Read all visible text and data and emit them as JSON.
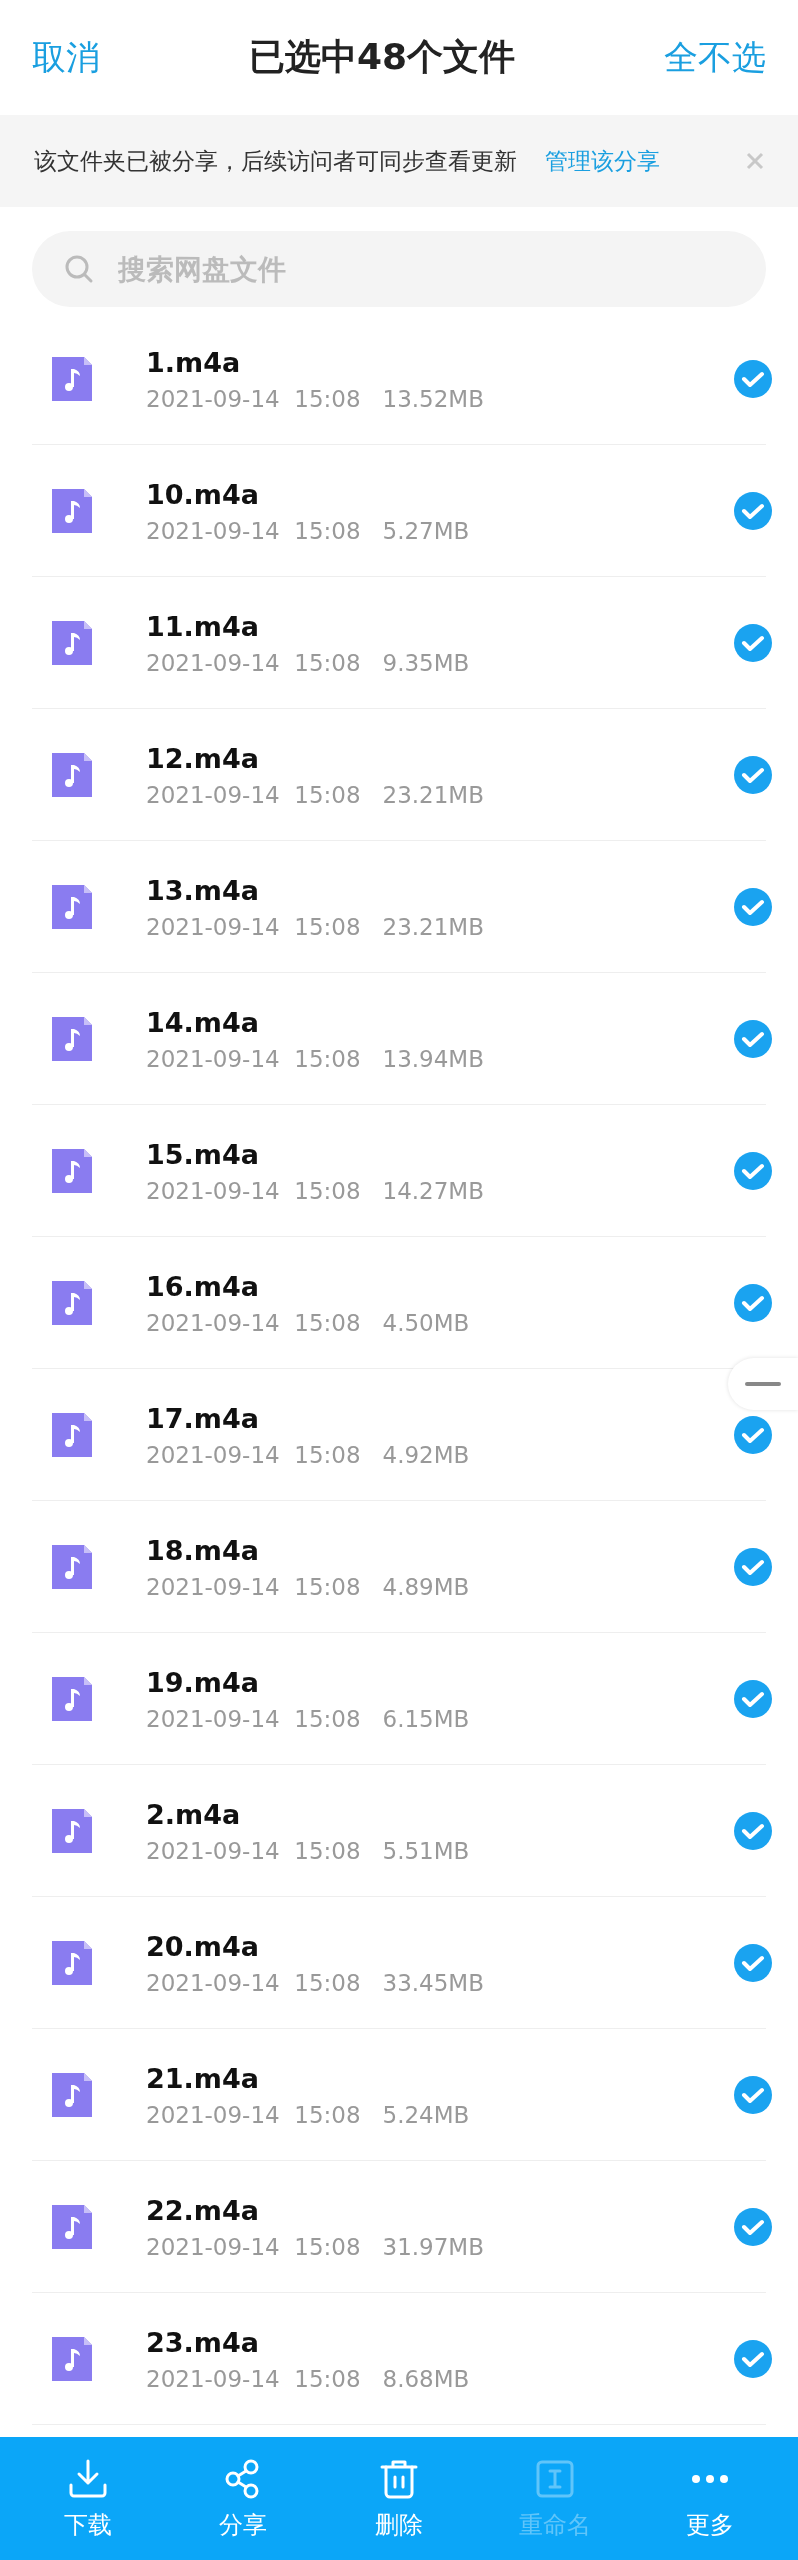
{
  "header": {
    "cancel": "取消",
    "title": "已选中48个文件",
    "deselect_all": "全不选"
  },
  "banner": {
    "message": "该文件夹已被分享，后续访问者可同步查看更新",
    "link": "管理该分享"
  },
  "search": {
    "placeholder": "搜索网盘文件"
  },
  "files": [
    {
      "name": "1.m4a",
      "date": "2021-09-14",
      "time": "15:08",
      "size": "13.52MB",
      "selected": true
    },
    {
      "name": "10.m4a",
      "date": "2021-09-14",
      "time": "15:08",
      "size": "5.27MB",
      "selected": true
    },
    {
      "name": "11.m4a",
      "date": "2021-09-14",
      "time": "15:08",
      "size": "9.35MB",
      "selected": true
    },
    {
      "name": "12.m4a",
      "date": "2021-09-14",
      "time": "15:08",
      "size": "23.21MB",
      "selected": true
    },
    {
      "name": "13.m4a",
      "date": "2021-09-14",
      "time": "15:08",
      "size": "23.21MB",
      "selected": true
    },
    {
      "name": "14.m4a",
      "date": "2021-09-14",
      "time": "15:08",
      "size": "13.94MB",
      "selected": true
    },
    {
      "name": "15.m4a",
      "date": "2021-09-14",
      "time": "15:08",
      "size": "14.27MB",
      "selected": true
    },
    {
      "name": "16.m4a",
      "date": "2021-09-14",
      "time": "15:08",
      "size": "4.50MB",
      "selected": true
    },
    {
      "name": "17.m4a",
      "date": "2021-09-14",
      "time": "15:08",
      "size": "4.92MB",
      "selected": true
    },
    {
      "name": "18.m4a",
      "date": "2021-09-14",
      "time": "15:08",
      "size": "4.89MB",
      "selected": true
    },
    {
      "name": "19.m4a",
      "date": "2021-09-14",
      "time": "15:08",
      "size": "6.15MB",
      "selected": true
    },
    {
      "name": "2.m4a",
      "date": "2021-09-14",
      "time": "15:08",
      "size": "5.51MB",
      "selected": true
    },
    {
      "name": "20.m4a",
      "date": "2021-09-14",
      "time": "15:08",
      "size": "33.45MB",
      "selected": true
    },
    {
      "name": "21.m4a",
      "date": "2021-09-14",
      "time": "15:08",
      "size": "5.24MB",
      "selected": true
    },
    {
      "name": "22.m4a",
      "date": "2021-09-14",
      "time": "15:08",
      "size": "31.97MB",
      "selected": true
    },
    {
      "name": "23.m4a",
      "date": "2021-09-14",
      "time": "15:08",
      "size": "8.68MB",
      "selected": true
    }
  ],
  "toolbar": [
    {
      "kind": "download",
      "label": "下载",
      "disabled": false
    },
    {
      "kind": "share",
      "label": "分享",
      "disabled": false
    },
    {
      "kind": "delete",
      "label": "删除",
      "disabled": false
    },
    {
      "kind": "rename",
      "label": "重命名",
      "disabled": true
    },
    {
      "kind": "more",
      "label": "更多",
      "disabled": false
    }
  ]
}
